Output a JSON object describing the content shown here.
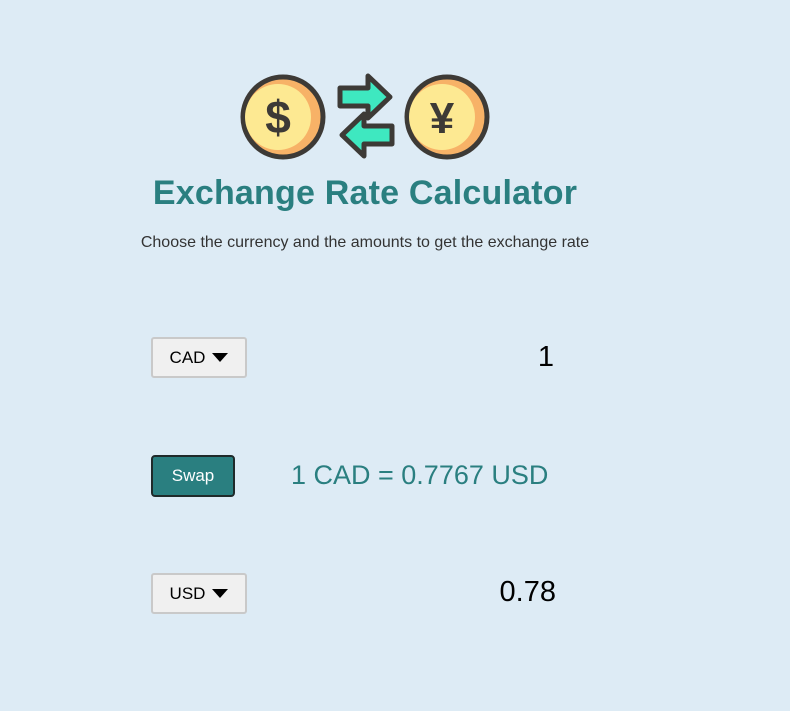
{
  "header": {
    "title": "Exchange Rate Calculator",
    "subtitle": "Choose the currency and the amounts to get the exchange rate"
  },
  "logo": {
    "left_coin_icon": "dollar-coin-icon",
    "arrows_icon": "exchange-arrows-icon",
    "right_coin_icon": "yen-coin-icon"
  },
  "from": {
    "currency": "CAD",
    "amount": "1"
  },
  "swap": {
    "label": "Swap"
  },
  "rate": {
    "text": "1 CAD = 0.7767 USD"
  },
  "to": {
    "currency": "USD",
    "amount": "0.78"
  },
  "colors": {
    "background": "#ddebf5",
    "accent": "#2a7f80",
    "coin": "#fde992",
    "arrow": "#3ee8c0"
  }
}
